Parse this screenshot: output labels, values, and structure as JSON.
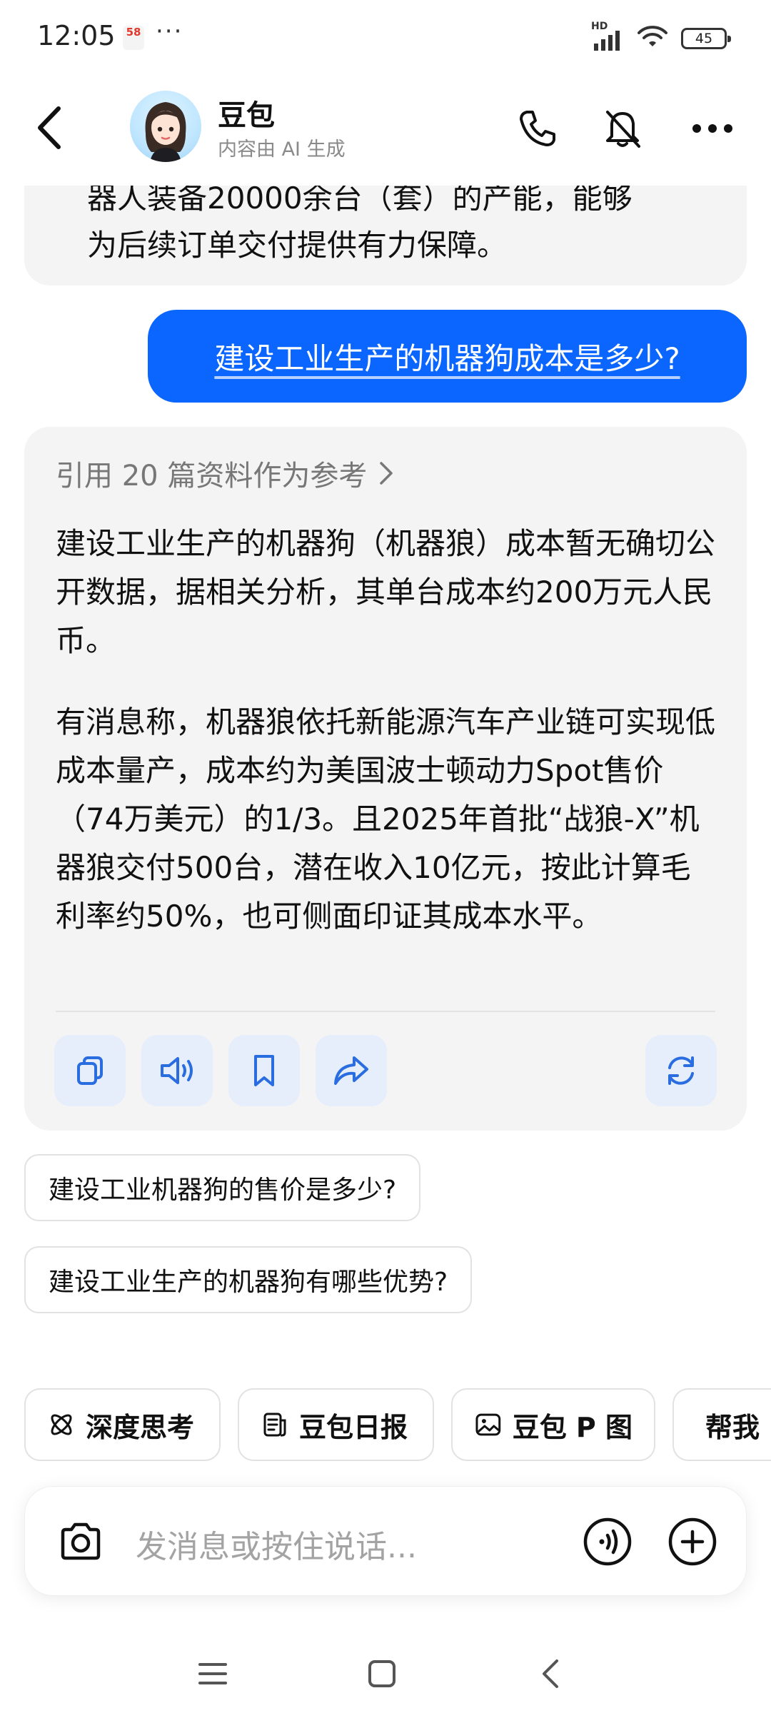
{
  "status_bar": {
    "time": "12:05",
    "app_badge": "58",
    "dots": "···",
    "network": "HD",
    "battery": "45"
  },
  "header": {
    "name": "豆包",
    "subtitle": "内容由 AI 生成",
    "icons": [
      "back-arrow-icon",
      "phone-icon",
      "mute-icon",
      "more-icon"
    ]
  },
  "messages": {
    "prev_bot_tail": {
      "line1": "器人装备20000余台（套）的产能，能够",
      "line2": "为后续订单交付提供有力保障。"
    },
    "user_question": "建设工业生产的机器狗成本是多少?",
    "ai_answer": {
      "references": "引用 20 篇资料作为参考",
      "paragraph1": "建设工业生产的机器狗（机器狼）成本暂无确切公开数据，据相关分析，其单台成本约200万元人民币。",
      "paragraph2": "有消息称，机器狼依托新能源汽车产业链可实现低成本量产，成本约为美国波士顿动力Spot售价（74万美元）的1/3。且2025年首批“战狼-X”机器狼交付500台，潜在收入10亿元，按此计算毛利率约50%，也可侧面印证其成本水平。",
      "actions": [
        "copy-icon",
        "speaker-icon",
        "bookmark-icon",
        "share-icon",
        "regenerate-icon"
      ]
    }
  },
  "suggestions": [
    "建设工业机器狗的售价是多少?",
    "建设工业生产的机器狗有哪些优势?"
  ],
  "chips": [
    {
      "label": "深度思考",
      "icon": "atom-icon"
    },
    {
      "label": "豆包日报",
      "icon": "report-icon"
    },
    {
      "label": "豆包 P 图",
      "icon": "image-edit-icon"
    },
    {
      "label": "帮我",
      "icon": "edit-icon"
    }
  ],
  "input": {
    "placeholder": "发消息或按住说话..."
  },
  "colors": {
    "accent": "#0a66ff",
    "bubble_bg": "#f4f4f5",
    "action_bg": "#e6eefc",
    "action_icon": "#2a6de0"
  }
}
